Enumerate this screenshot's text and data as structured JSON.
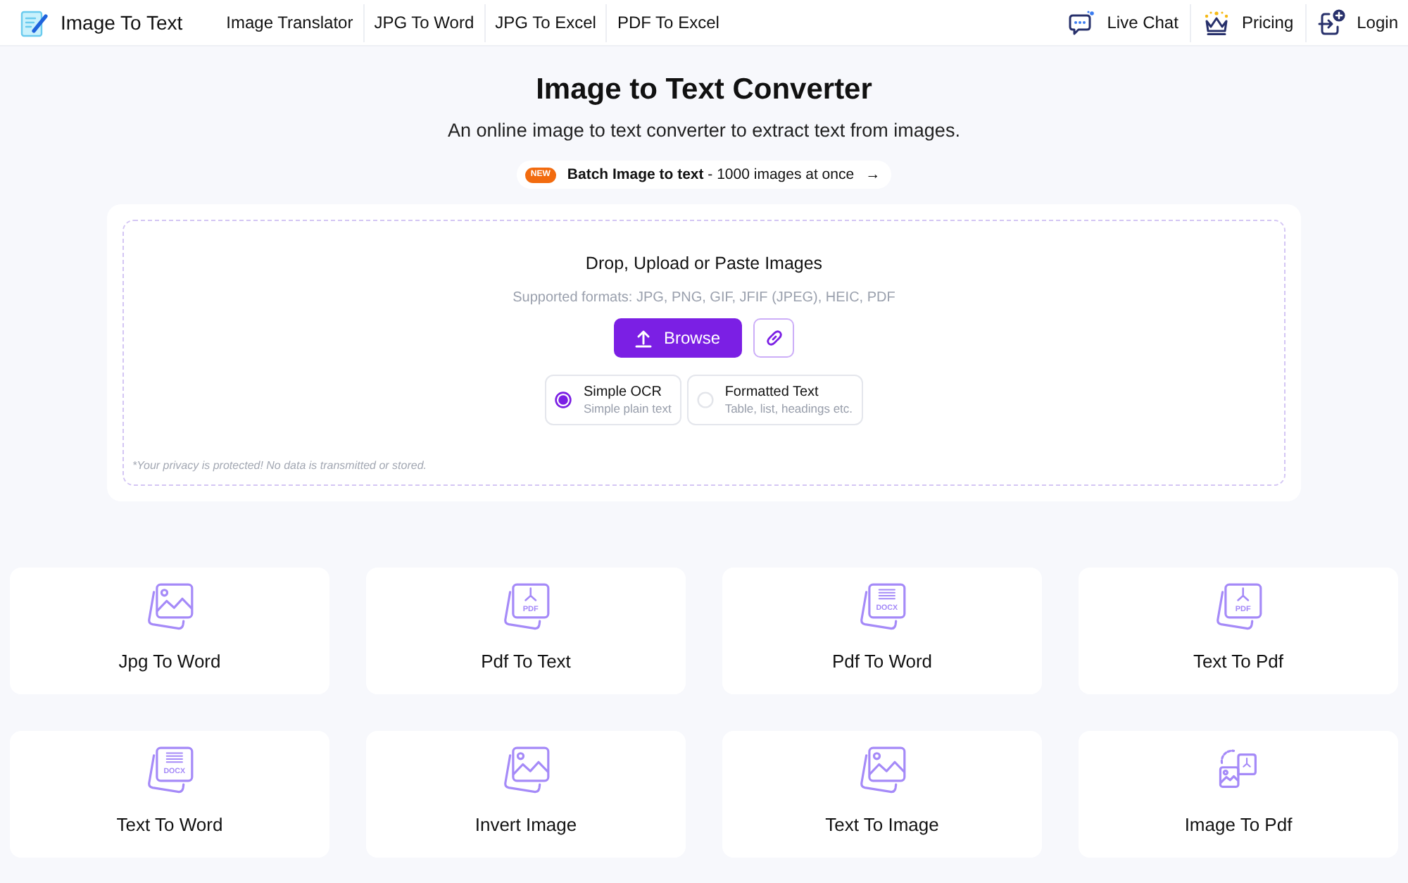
{
  "header": {
    "logo_text": "Image To Text",
    "nav_links": [
      "Image Translator",
      "JPG To Word",
      "JPG To Excel",
      "PDF To Excel"
    ],
    "actions": [
      {
        "kind": "chat",
        "label": "Live Chat"
      },
      {
        "kind": "pricing",
        "label": "Pricing"
      },
      {
        "kind": "login",
        "label": "Login"
      }
    ]
  },
  "hero": {
    "title": "Image to Text Converter",
    "subtitle": "An online image to text converter to extract text from images.",
    "promo": {
      "badge": "NEW",
      "text": "**Batch Image to text** - 1000 images at once",
      "arrow": "→"
    }
  },
  "upload": {
    "heading": "Drop, Upload or Paste Images",
    "formats": "Supported formats: JPG, PNG, GIF, JFIF (JPEG), HEIC, PDF",
    "browse_button": "Browse",
    "modes": [
      {
        "title": "Simple OCR",
        "description": "Simple plain text",
        "selected": true
      },
      {
        "title": "Formatted Text",
        "description": "Table, list, headings etc.",
        "selected": false
      }
    ],
    "privacy_note": "*Your privacy is protected! No data is transmitted or stored."
  },
  "tools": [
    {
      "label": "Jpg To Word",
      "kind": "image"
    },
    {
      "label": "Pdf To Text",
      "kind": "pdf",
      "icon_text": "PDF"
    },
    {
      "label": "Pdf To Word",
      "kind": "docx",
      "icon_text": "DOCX"
    },
    {
      "label": "Text To Pdf",
      "kind": "pdf",
      "icon_text": "PDF"
    },
    {
      "label": "Text To Word",
      "kind": "docx",
      "icon_text": "DOCX"
    },
    {
      "label": "Invert Image",
      "kind": "image"
    },
    {
      "label": "Text To Image",
      "kind": "image"
    },
    {
      "label": "Image To Pdf",
      "kind": "convert"
    }
  ]
}
